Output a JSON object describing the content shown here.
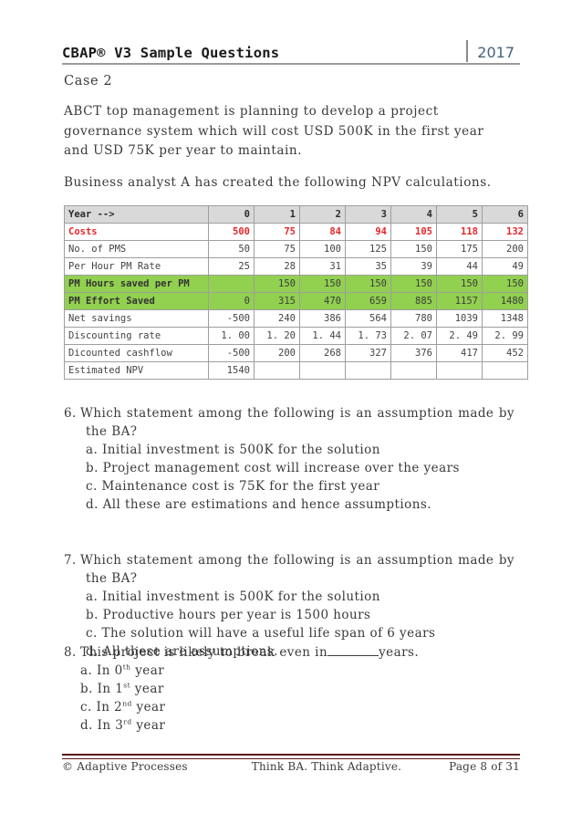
{
  "header": {
    "title": "CBAP® V3 Sample Questions",
    "year": "2017"
  },
  "body": {
    "case_title": "Case 2",
    "paragraph_1": "ABCT top management is planning to develop a project governance system which will cost USD 500K in the first year and USD 75K per year to maintain.",
    "paragraph_2": "Business analyst A has created the following NPV calculations."
  },
  "table": {
    "row_header_label": "Year -->",
    "year_columns": [
      "0",
      "1",
      "2",
      "3",
      "4",
      "5",
      "6"
    ],
    "rows": [
      {
        "label": "Costs",
        "style": "costs",
        "values": [
          "500",
          "75",
          "84",
          "94",
          "105",
          "118",
          "132"
        ]
      },
      {
        "label": "No. of PMS",
        "style": "plain",
        "values": [
          "50",
          "75",
          "100",
          "125",
          "150",
          "175",
          "200"
        ]
      },
      {
        "label": "Per Hour PM Rate",
        "style": "plain",
        "values": [
          "25",
          "28",
          "31",
          "35",
          "39",
          "44",
          "49"
        ]
      },
      {
        "label": "PM Hours saved per PM",
        "style": "green",
        "values": [
          "",
          "150",
          "150",
          "150",
          "150",
          "150",
          "150"
        ]
      },
      {
        "label": "PM Effort Saved",
        "style": "green",
        "values": [
          "0",
          "315",
          "470",
          "659",
          "885",
          "1157",
          "1480"
        ]
      },
      {
        "label": "Net savings",
        "style": "plain",
        "values": [
          "-500",
          "240",
          "386",
          "564",
          "780",
          "1039",
          "1348"
        ]
      },
      {
        "label": "Discounting rate",
        "style": "plain",
        "values": [
          "1. 00",
          "1. 20",
          "1. 44",
          "1. 73",
          "2. 07",
          "2. 49",
          "2. 99"
        ]
      },
      {
        "label": "Dicounted cashflow",
        "style": "plain",
        "values": [
          "-500",
          "200",
          "268",
          "327",
          "376",
          "417",
          "452"
        ]
      },
      {
        "label": "Estimated NPV",
        "style": "plain",
        "values": [
          "1540",
          "",
          "",
          "",
          "",
          "",
          ""
        ]
      }
    ],
    "colors": {
      "header_fill": "#d9d9d9",
      "highlight_fill": "#92d050",
      "costs_text": "#e8252a",
      "border": "#9e9e9e"
    }
  },
  "questions": [
    {
      "number": "6.",
      "stem": "Which statement among the following is an assumption made by the BA?",
      "options": [
        "a. Initial investment is 500K for the solution",
        "b. Project management cost will increase over the years",
        "c. Maintenance cost is 75K for the first year",
        "d. All these are estimations and hence assumptions."
      ]
    },
    {
      "number": "7.",
      "stem": "Which statement among the following is an assumption made by the BA?",
      "options": [
        "a. Initial investment is 500K for the solution",
        "b. Productive hours per year is 1500 hours",
        "c. The solution will have a useful life span of 6 years",
        "d. All these are assumptions."
      ]
    }
  ],
  "question8": {
    "number": "8.",
    "stem_before_blank": "This project is likely to break even in",
    "stem_after_blank": "years.",
    "options": [
      {
        "prefix": "a. In 0",
        "sup": "th",
        "suffix": " year"
      },
      {
        "prefix": "b. In 1",
        "sup": "st",
        "suffix": " year"
      },
      {
        "prefix": "c. In 2",
        "sup": "nd",
        "suffix": " year"
      },
      {
        "prefix": "d. In 3",
        "sup": "rd",
        "suffix": " year"
      }
    ]
  },
  "footer": {
    "copyright": "© Adaptive Processes",
    "tagline": "Think BA. Think Adaptive.",
    "page": "Page 8 of 31",
    "rule_color": "#5a1414"
  }
}
